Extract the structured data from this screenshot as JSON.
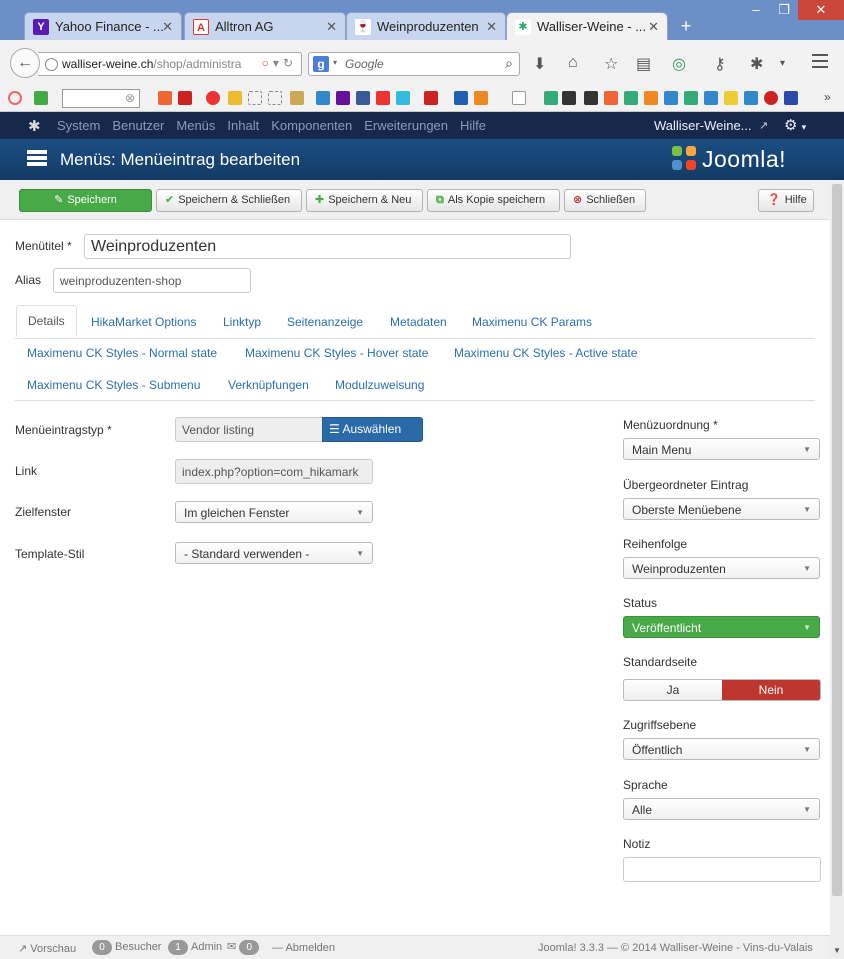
{
  "browser": {
    "tabs": [
      {
        "title": "Yahoo Finance - ...",
        "icon": "yahoo-icon",
        "color": "#5a1ab3"
      },
      {
        "title": "Alltron AG",
        "icon": "alltron-icon",
        "color": "#d33"
      },
      {
        "title": "Weinproduzenten",
        "icon": "wine-icon",
        "color": "#b12"
      },
      {
        "title": "Walliser-Weine - ...",
        "icon": "joomla-icon",
        "color": "#2a6"
      }
    ],
    "url": {
      "host": "walliser-weine.ch",
      "path": "/shop/administra"
    },
    "search": {
      "engine": "Google",
      "placeholder": "Google"
    }
  },
  "topnav": {
    "items": [
      "System",
      "Benutzer",
      "Menüs",
      "Inhalt",
      "Komponenten",
      "Erweiterungen",
      "Hilfe"
    ],
    "site": "Walliser-Weine..."
  },
  "header": {
    "title": "Menüs: Menüeintrag bearbeiten",
    "logo": "Joomla!"
  },
  "toolbar": {
    "save": "Speichern",
    "save_close": "Speichern & Schließen",
    "save_new": "Speichern & Neu",
    "save_copy": "Als Kopie speichern",
    "close": "Schließen",
    "help": "Hilfe"
  },
  "form": {
    "title_label": "Menütitel *",
    "title_value": "Weinproduzenten",
    "alias_label": "Alias",
    "alias_value": "weinproduzenten-shop"
  },
  "tabs": {
    "row1": [
      "Details",
      "HikaMarket Options",
      "Linktyp",
      "Seitenanzeige",
      "Metadaten",
      "Maximenu CK Params"
    ],
    "row2": [
      "Maximenu CK Styles - Normal state",
      "Maximenu CK Styles - Hover state",
      "Maximenu CK Styles - Active state"
    ],
    "row3": [
      "Maximenu CK Styles - Submenu",
      "Verknüpfungen",
      "Modulzuweisung"
    ]
  },
  "details": {
    "type_label": "Menüeintragstyp *",
    "type_value": "Vendor listing",
    "select_button": "Auswählen",
    "link_label": "Link",
    "link_value": "index.php?option=com_hikamark",
    "target_label": "Zielfenster",
    "target_value": "Im gleichen Fenster",
    "template_label": "Template-Stil",
    "template_value": "- Standard verwenden -"
  },
  "sidebar": {
    "menu_label": "Menüzuordnung *",
    "menu_value": "Main Menu",
    "parent_label": "Übergeordneter Eintrag",
    "parent_value": "Oberste Menüebene",
    "order_label": "Reihenfolge",
    "order_value": "Weinproduzenten",
    "status_label": "Status",
    "status_value": "Veröffentlicht",
    "default_label": "Standardseite",
    "default_yes": "Ja",
    "default_no": "Nein",
    "access_label": "Zugriffsebene",
    "access_value": "Öffentlich",
    "language_label": "Sprache",
    "language_value": "Alle",
    "note_label": "Notiz",
    "note_value": ""
  },
  "status": {
    "preview": "Vorschau",
    "visitors_count": "0",
    "visitors": "Besucher",
    "admin_count": "1",
    "admin": "Admin",
    "messages_count": "0",
    "logout": "Abmelden",
    "version": "Joomla! 3.3.3",
    "copyright": "— © 2014 Walliser-Weine - Vins-du-Valais"
  },
  "colors": {
    "topnav": "#17294b",
    "header": "#1c4e83",
    "save_green": "#48a947",
    "primary_blue": "#2b6aa8",
    "danger_red": "#bd362f",
    "link": "#2a6fb0"
  }
}
